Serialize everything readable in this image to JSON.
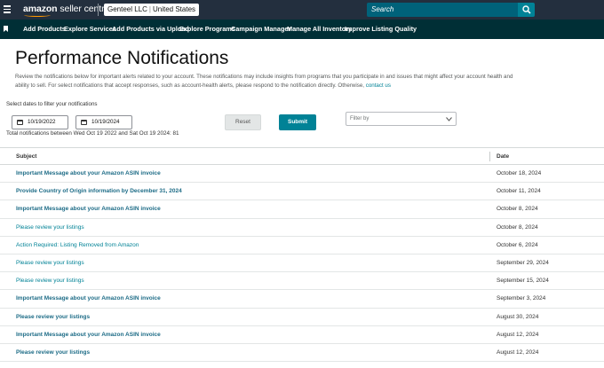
{
  "header": {
    "logo_brand": "amazon",
    "logo_product": "seller central",
    "account_name": "Genteel LLC",
    "account_region": "United States",
    "search_placeholder": "Search"
  },
  "nav": {
    "items": [
      {
        "label": "Add Products"
      },
      {
        "label": "Explore Services"
      },
      {
        "label": "Add Products via Upload"
      },
      {
        "label": "Explore Programs"
      },
      {
        "label": "Campaign Manager"
      },
      {
        "label": "Manage All Inventory"
      },
      {
        "label": "Improve Listing Quality"
      }
    ]
  },
  "page": {
    "title": "Performance Notifications",
    "intro": "Review the notifications below for important alerts related to your account. These notifications may include insights from programs that you participate in and issues that might affect your account health and ability to sell. For select notifications that accept responses, such as account-health alerts, please respond to the notification directly. Otherwise,",
    "intro_link": "contact us"
  },
  "filters": {
    "label": "Select dates to filter your notifications",
    "start_date": "10/19/2022",
    "end_date": "10/19/2024",
    "reset_label": "Reset",
    "submit_label": "Submit",
    "filter_by_placeholder": "Filter by",
    "total_text": "Total notifications between Wed Oct 19 2022 and Sat Oct 19 2024: 81"
  },
  "table": {
    "columns": [
      "Subject",
      "Date"
    ],
    "rows": [
      {
        "subject": "Important Message about your Amazon ASIN invoice",
        "date": "October 18, 2024",
        "unread": true
      },
      {
        "subject": "Provide Country of Origin information by December 31, 2024",
        "date": "October 11, 2024",
        "unread": true
      },
      {
        "subject": "Important Message about your Amazon ASIN invoice",
        "date": "October 8, 2024",
        "unread": true
      },
      {
        "subject": "Please review your listings",
        "date": "October 8, 2024",
        "unread": false
      },
      {
        "subject": "Action Required: Listing Removed from Amazon",
        "date": "October 6, 2024",
        "unread": false
      },
      {
        "subject": "Please review your listings",
        "date": "September 29, 2024",
        "unread": false
      },
      {
        "subject": "Please review your listings",
        "date": "September 15, 2024",
        "unread": false
      },
      {
        "subject": "Important Message about your Amazon ASIN invoice",
        "date": "September 3, 2024",
        "unread": true
      },
      {
        "subject": "Please review your listings",
        "date": "August 30, 2024",
        "unread": true
      },
      {
        "subject": "Important Message about your Amazon ASIN invoice",
        "date": "August 12, 2024",
        "unread": true
      },
      {
        "subject": "Please review your listings",
        "date": "August 12, 2024",
        "unread": true
      }
    ]
  },
  "colors": {
    "topbar": "#232f3e",
    "navbar": "#002f36",
    "accent": "#008296",
    "logo_smile": "#ff9900"
  },
  "icons": {
    "menu": "hamburger-icon",
    "search": "search-icon",
    "bookmark": "bookmark-icon",
    "calendar": "calendar-icon",
    "dropdown": "chevron-down-icon"
  }
}
